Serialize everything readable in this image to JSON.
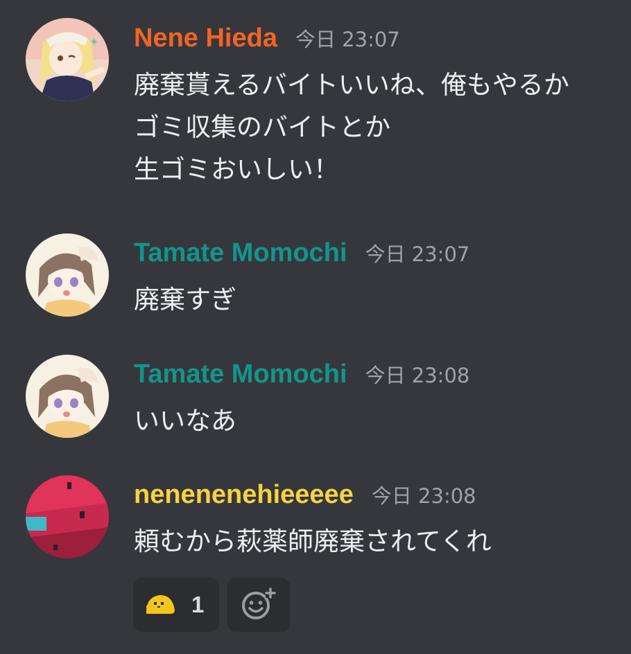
{
  "messages": [
    {
      "author": "Nene Hieda",
      "author_color": "#f26522",
      "time": "今日 23:07",
      "avatar": "anime-girl-blonde-avatar",
      "lines": [
        "廃棄貰えるバイトいいね、俺もやるか",
        "ゴミ収集のバイトとか",
        "生ゴミおいしい！"
      ]
    },
    {
      "author": "Tamate Momochi",
      "author_color": "#11968a",
      "time": "今日 23:07",
      "avatar": "anime-girl-brown-hair-avatar",
      "lines": [
        "廃棄すぎ"
      ]
    },
    {
      "author": "Tamate Momochi",
      "author_color": "#11968a",
      "time": "今日 23:08",
      "avatar": "anime-girl-brown-hair-avatar",
      "lines": [
        "いいなあ"
      ]
    },
    {
      "author": "nenenenehieeeee",
      "author_color": "#f7d33e",
      "time": "今日 23:08",
      "avatar": "pink-object-avatar",
      "lines": [
        "頼むから萩薬師廃棄されてくれ"
      ]
    }
  ],
  "reactions": [
    {
      "emoji": "yellow-blob-emoji",
      "count": "1"
    }
  ],
  "add_reaction_icon": "add-reaction-icon",
  "colors": {
    "background": "#36373d",
    "text": "#eceef1",
    "timestamp": "#a0a3a8",
    "reaction_bg": "#2b2d31",
    "emoji_yellow": "#f5c518"
  }
}
